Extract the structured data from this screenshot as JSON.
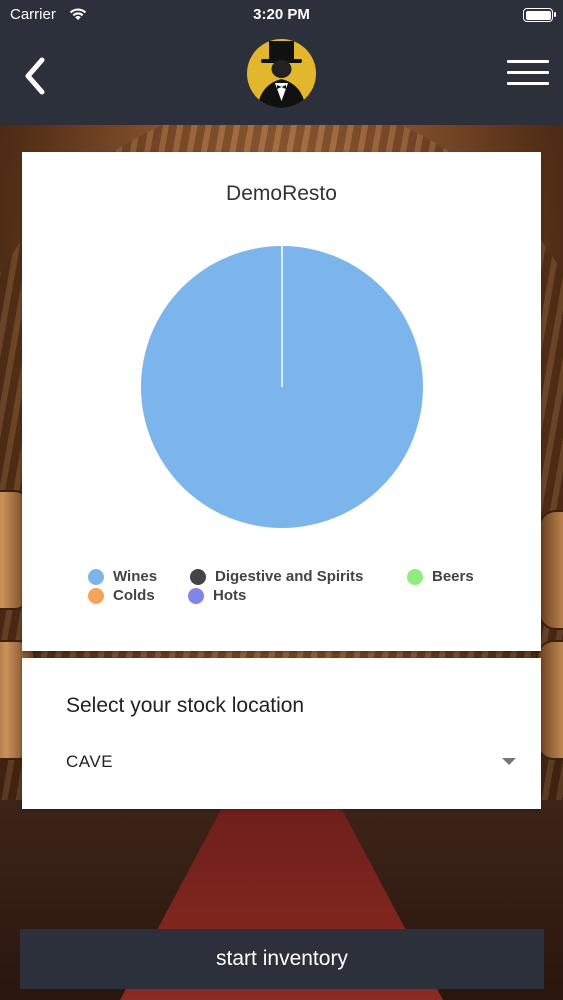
{
  "status_bar": {
    "carrier": "Carrier",
    "time": "3:20 PM"
  },
  "nav": {
    "back_icon": "chevron-left-icon",
    "logo_icon": "top-hat-butler-logo",
    "menu_icon": "hamburger-menu-icon"
  },
  "chart": {
    "title": "DemoResto"
  },
  "chart_data": {
    "type": "pie",
    "title": "DemoResto",
    "categories": [
      "Wines",
      "Digestive and Spirits",
      "Beers",
      "Colds",
      "Hots"
    ],
    "values": [
      100,
      0,
      0,
      0,
      0
    ],
    "colors": [
      "#7cb5ec",
      "#434348",
      "#90ed7d",
      "#f7a35c",
      "#8085e9"
    ],
    "legend_placement": "bottom"
  },
  "legend": [
    {
      "label": "Wines",
      "color": "#7cb5ec"
    },
    {
      "label": "Digestive and Spirits",
      "color": "#434348"
    },
    {
      "label": "Beers",
      "color": "#90ed7d"
    },
    {
      "label": "Colds",
      "color": "#f7a35c"
    },
    {
      "label": "Hots",
      "color": "#8085e9"
    }
  ],
  "location": {
    "label": "Select your stock location",
    "selected": "CAVE"
  },
  "actions": {
    "start_label": "start inventory"
  },
  "colors": {
    "nav_bg": "#2b303b",
    "logo_bg": "#e3b72d"
  }
}
